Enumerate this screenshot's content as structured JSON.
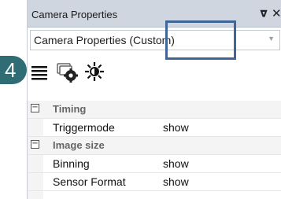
{
  "badge": {
    "number": "4"
  },
  "window": {
    "title": "Camera Properties"
  },
  "combo": {
    "value": "Camera Properties (Custom)"
  },
  "toolbar": {
    "buttons": [
      "list-view-icon",
      "camera-settings-icon",
      "brightness-icon"
    ]
  },
  "properties": {
    "categories": [
      {
        "label": "Timing",
        "expanded": true,
        "toggle": "−",
        "items": [
          {
            "name": "Triggermode",
            "value": "show"
          }
        ]
      },
      {
        "label": "Image size",
        "expanded": true,
        "toggle": "−",
        "items": [
          {
            "name": "Binning",
            "value": "show"
          },
          {
            "name": "Sensor Format",
            "value": "show"
          }
        ]
      }
    ]
  },
  "colors": {
    "badge": "#2f6c74",
    "highlight": "#3f6697",
    "titlebar": "#cfd6e0"
  }
}
